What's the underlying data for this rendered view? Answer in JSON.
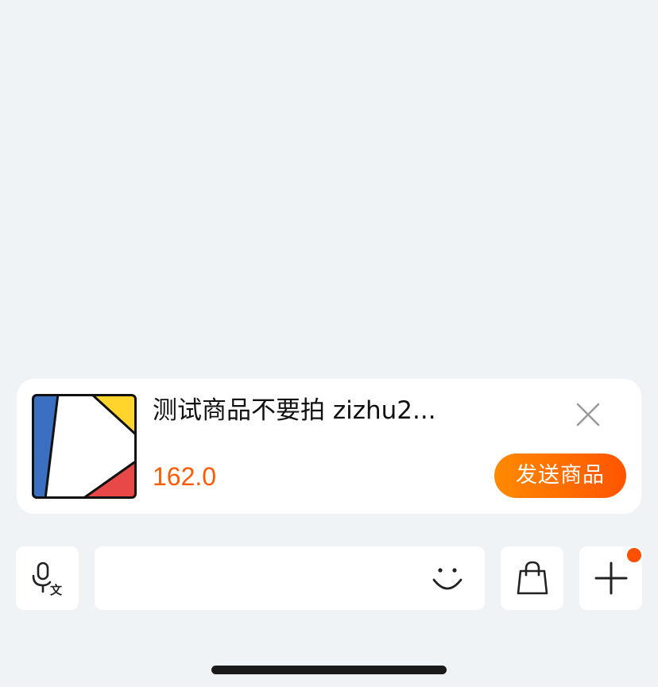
{
  "product_card": {
    "title": "测试商品不要拍 zizhu2...",
    "price": "162.0",
    "send_label": "发送商品",
    "thumbnail_colors": [
      "#3b6fbf",
      "#ffd52b",
      "#e94848",
      "#ffffff"
    ]
  },
  "input_bar": {
    "text_value": "",
    "placeholder": "",
    "icons": [
      "voice-translate-icon",
      "emoji-icon",
      "shopping-bag-icon",
      "plus-icon"
    ],
    "notification_dot_color": "#ff5000"
  },
  "colors": {
    "background": "#eff3f6",
    "price": "#ff5a00",
    "button_gradient_start": "#ff8a00",
    "button_gradient_end": "#ff5400"
  }
}
